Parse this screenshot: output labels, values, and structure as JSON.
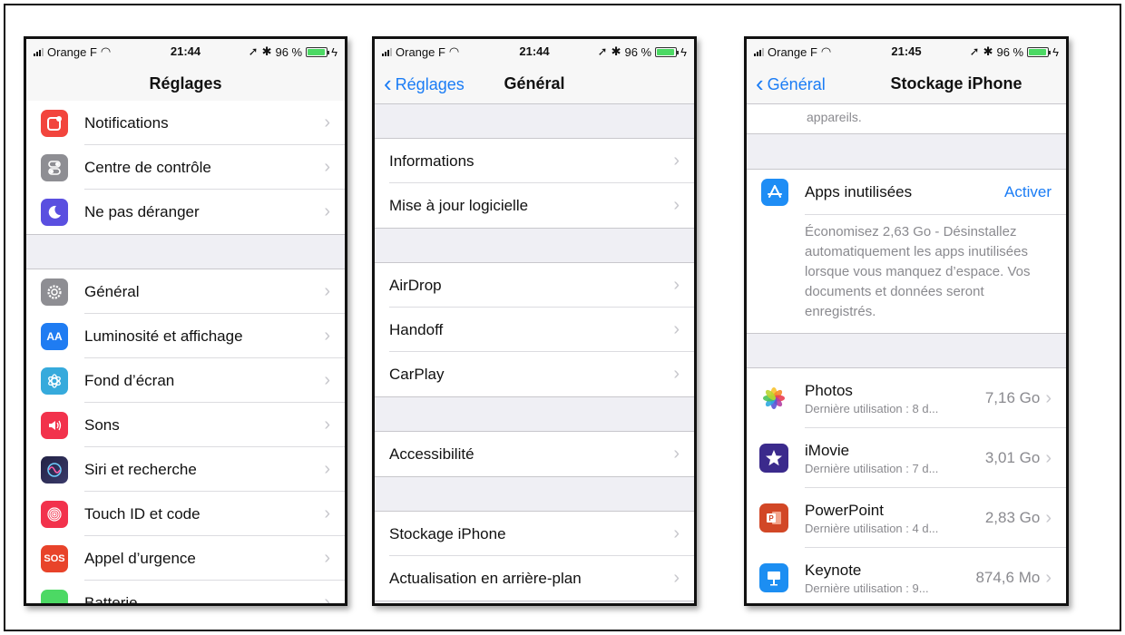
{
  "status": {
    "carrier": "Orange F",
    "battery": "96 %",
    "time1": "21:44",
    "time2": "21:44",
    "time3": "21:45",
    "battery_level": 0.96
  },
  "phone1": {
    "title": "Réglages",
    "items": [
      {
        "label": "Notifications",
        "icon": "notifications-icon",
        "color": "#f2453d"
      },
      {
        "label": "Centre de contrôle",
        "icon": "control-center-icon",
        "color": "#8e8e93"
      },
      {
        "label": "Ne pas déranger",
        "icon": "moon-icon",
        "color": "#5a4fe0"
      },
      {
        "label": "Général",
        "icon": "gear-icon",
        "color": "#8e8e93"
      },
      {
        "label": "Luminosité et affichage",
        "icon": "display-icon",
        "color": "#1f7cf2"
      },
      {
        "label": "Fond d’écran",
        "icon": "wallpaper-icon",
        "color": "#36aadc"
      },
      {
        "label": "Sons",
        "icon": "speaker-icon",
        "color": "#f2324c"
      },
      {
        "label": "Siri et recherche",
        "icon": "siri-icon",
        "color": "#222244"
      },
      {
        "label": "Touch ID et code",
        "icon": "fingerprint-icon",
        "color": "#f2324c"
      },
      {
        "label": "Appel d’urgence",
        "icon": "sos-icon",
        "color": "#e8432a"
      },
      {
        "label": "Batterie",
        "icon": "battery-icon",
        "color": "#4cd964"
      }
    ],
    "icon_text_aa": "AA",
    "icon_text_sos": "SOS"
  },
  "phone2": {
    "back": "Réglages",
    "title": "Général",
    "items": [
      "Informations",
      "Mise à jour logicielle",
      "AirDrop",
      "Handoff",
      "CarPlay",
      "Accessibilité",
      "Stockage iPhone",
      "Actualisation en arrière-plan"
    ]
  },
  "phone3": {
    "back": "Général",
    "title": "Stockage iPhone",
    "top_text": "appareils.",
    "offload": {
      "label": "Apps inutilisées",
      "action": "Activer",
      "description": "Économisez 2,63 Go - Désinstallez automatiquement les apps inutilisées lorsque vous manquez d’espace. Vos documents et données seront enregistrés."
    },
    "apps": [
      {
        "name": "Photos",
        "sub": "Dernière utilisation : 8 d...",
        "size": "7,16 Go",
        "icon": "photos-icon"
      },
      {
        "name": "iMovie",
        "sub": "Dernière utilisation : 7 d...",
        "size": "3,01 Go",
        "icon": "imovie-icon",
        "color": "#3b2a8c"
      },
      {
        "name": "PowerPoint",
        "sub": "Dernière utilisation : 4 d...",
        "size": "2,83 Go",
        "icon": "powerpoint-icon",
        "color": "#d24726"
      },
      {
        "name": "Keynote",
        "sub": "Dernière utilisation : 9...",
        "size": "874,6 Mo",
        "icon": "keynote-icon",
        "color": "#1c8ef2"
      }
    ]
  }
}
